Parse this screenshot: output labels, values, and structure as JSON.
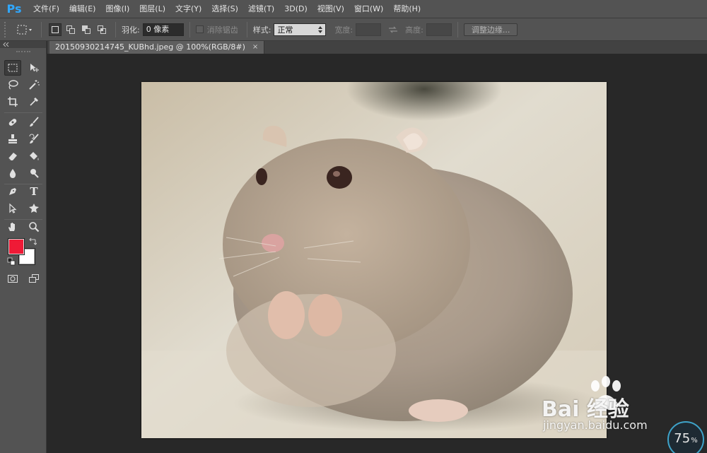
{
  "app": {
    "logo": "Ps"
  },
  "menu": {
    "items": [
      "文件(F)",
      "编辑(E)",
      "图像(I)",
      "图层(L)",
      "文字(Y)",
      "选择(S)",
      "滤镜(T)",
      "3D(D)",
      "视图(V)",
      "窗口(W)",
      "帮助(H)"
    ]
  },
  "options": {
    "feather_label": "羽化:",
    "feather_value": "0 像素",
    "antialias_label": "消除锯齿",
    "style_label": "样式:",
    "style_value": "正常",
    "width_label": "宽度:",
    "height_label": "高度:",
    "refine_edge_button": "调整边缘..."
  },
  "document": {
    "tab_title": "20150930214745_KUBhd.jpeg @ 100%(RGB/8#)",
    "close_glyph": "×"
  },
  "colors": {
    "foreground": "#ef1a36",
    "background": "#ffffff",
    "accent": "#30a8ff"
  },
  "tools": {
    "text_tool_glyph": "T"
  },
  "watermark": {
    "main": "Bai  经验",
    "sub": "jingyan.baidu.com"
  },
  "zoom": {
    "value": "75",
    "unit": "%"
  }
}
